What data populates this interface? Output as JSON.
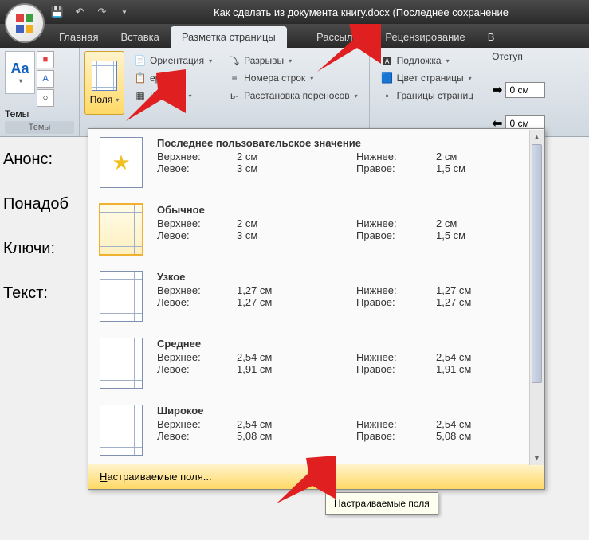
{
  "title": "Как сделать из документа книгу.docx (Последнее сохранение",
  "tabs": [
    "Главная",
    "Вставка",
    "Разметка страницы",
    "Рассылки",
    "Рецензирование",
    "В"
  ],
  "active_tab": "Разметка страницы",
  "themes": {
    "label": "Темы",
    "main": "Aa",
    "btn1": "■",
    "btn2": "A",
    "btn3": "○"
  },
  "polya": {
    "label": "Поля"
  },
  "cmds1": {
    "orient": "Ориентация",
    "size": "ер",
    "cols": "Коло   ки"
  },
  "cmds2": {
    "breaks": "Разрывы",
    "lines": "Номера строк",
    "hyph": "Расстановка переносов"
  },
  "cmds3": {
    "water": "Подложка",
    "color": "Цвет страницы",
    "border": "Границы страниц"
  },
  "otstup": {
    "label": "Отступ",
    "v1": "0 см",
    "v2": "0 см"
  },
  "margins": [
    {
      "name": "Последнее пользовательское значение",
      "top": "2 см",
      "bot": "2 см",
      "left": "3 см",
      "right": "1,5 см",
      "star": true
    },
    {
      "name": "Обычное",
      "top": "2 см",
      "bot": "2 см",
      "left": "3 см",
      "right": "1,5 см",
      "selected": true
    },
    {
      "name": "Узкое",
      "top": "1,27 см",
      "bot": "1,27 см",
      "left": "1,27 см",
      "right": "1,27 см"
    },
    {
      "name": "Среднее",
      "top": "2,54 см",
      "bot": "2,54 см",
      "left": "1,91 см",
      "right": "1,91 см"
    },
    {
      "name": "Широкое",
      "top": "2,54 см",
      "bot": "2,54 см",
      "left": "5,08 см",
      "right": "5,08 см"
    }
  ],
  "margin_labels": {
    "top": "Верхнее:",
    "bot": "Нижнее:",
    "left": "Левое:",
    "right": "Правое:"
  },
  "custom": "Настраиваемые поля...",
  "tooltip": "Настраиваемые поля",
  "doc": {
    "l1": "Анонс:",
    "l2": "Понадоб",
    "l3": "Ключи:",
    "l4": "Текст:"
  }
}
